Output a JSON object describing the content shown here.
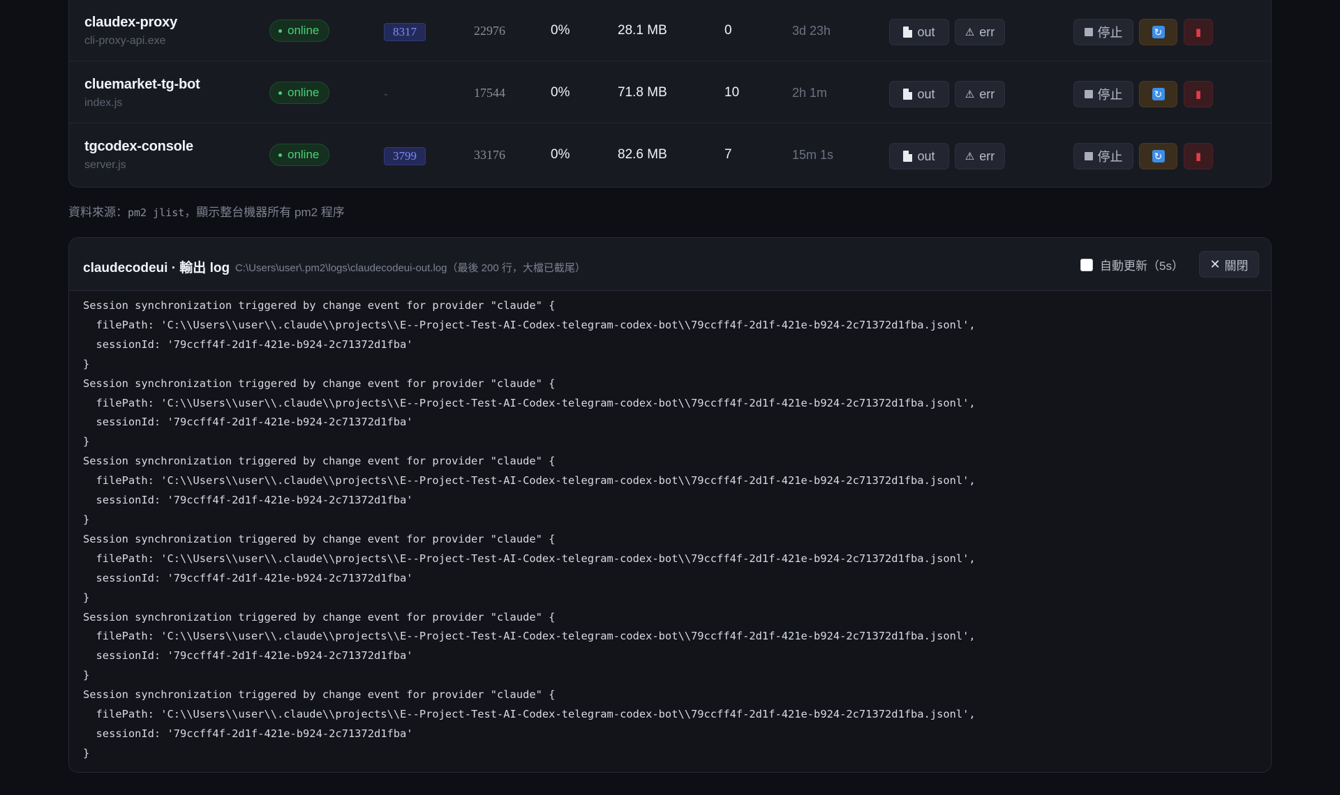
{
  "processes": [
    {
      "name": "claudex-proxy",
      "script": "cli-proxy-api.exe",
      "status": "online",
      "port": "8317",
      "pid": "22976",
      "cpu": "0%",
      "memory": "28.1 MB",
      "restarts": "0",
      "uptime": "3d 23h"
    },
    {
      "name": "cluemarket-tg-bot",
      "script": "index.js",
      "status": "online",
      "port": "-",
      "pid": "17544",
      "cpu": "0%",
      "memory": "71.8 MB",
      "restarts": "10",
      "uptime": "2h 1m"
    },
    {
      "name": "tgcodex-console",
      "script": "server.js",
      "status": "online",
      "port": "3799",
      "pid": "33176",
      "cpu": "0%",
      "memory": "82.6 MB",
      "restarts": "7",
      "uptime": "15m 1s"
    }
  ],
  "row_actions": {
    "out_label": "out",
    "err_label": "err",
    "stop_label": "停止"
  },
  "source_note": {
    "prefix": "資料來源：",
    "command": "pm2 jlist",
    "suffix": "，顯示整台機器所有 pm2 程序"
  },
  "log_panel": {
    "title": "claudecodeui · 輸出 log",
    "path": "C:\\Users\\user\\.pm2\\logs\\claudecodeui-out.log（最後 200 行，大檔已截尾）",
    "auto_refresh_label": "自動更新（5s）",
    "auto_refresh_checked": false,
    "close_label": "關閉",
    "lines": [
      "Session synchronization triggered by change event for provider \"claude\" {",
      "  filePath: 'C:\\\\Users\\\\user\\\\.claude\\\\projects\\\\E--Project-Test-AI-Codex-telegram-codex-bot\\\\79ccff4f-2d1f-421e-b924-2c71372d1fba.jsonl',",
      "  sessionId: '79ccff4f-2d1f-421e-b924-2c71372d1fba'",
      "}",
      "Session synchronization triggered by change event for provider \"claude\" {",
      "  filePath: 'C:\\\\Users\\\\user\\\\.claude\\\\projects\\\\E--Project-Test-AI-Codex-telegram-codex-bot\\\\79ccff4f-2d1f-421e-b924-2c71372d1fba.jsonl',",
      "  sessionId: '79ccff4f-2d1f-421e-b924-2c71372d1fba'",
      "}",
      "Session synchronization triggered by change event for provider \"claude\" {",
      "  filePath: 'C:\\\\Users\\\\user\\\\.claude\\\\projects\\\\E--Project-Test-AI-Codex-telegram-codex-bot\\\\79ccff4f-2d1f-421e-b924-2c71372d1fba.jsonl',",
      "  sessionId: '79ccff4f-2d1f-421e-b924-2c71372d1fba'",
      "}",
      "Session synchronization triggered by change event for provider \"claude\" {",
      "  filePath: 'C:\\\\Users\\\\user\\\\.claude\\\\projects\\\\E--Project-Test-AI-Codex-telegram-codex-bot\\\\79ccff4f-2d1f-421e-b924-2c71372d1fba.jsonl',",
      "  sessionId: '79ccff4f-2d1f-421e-b924-2c71372d1fba'",
      "}",
      "Session synchronization triggered by change event for provider \"claude\" {",
      "  filePath: 'C:\\\\Users\\\\user\\\\.claude\\\\projects\\\\E--Project-Test-AI-Codex-telegram-codex-bot\\\\79ccff4f-2d1f-421e-b924-2c71372d1fba.jsonl',",
      "  sessionId: '79ccff4f-2d1f-421e-b924-2c71372d1fba'",
      "}",
      "Session synchronization triggered by change event for provider \"claude\" {",
      "  filePath: 'C:\\\\Users\\\\user\\\\.claude\\\\projects\\\\E--Project-Test-AI-Codex-telegram-codex-bot\\\\79ccff4f-2d1f-421e-b924-2c71372d1fba.jsonl',",
      "  sessionId: '79ccff4f-2d1f-421e-b924-2c71372d1fba'",
      "}"
    ]
  },
  "colors": {
    "background": "#0e0f14",
    "card": "#181a22",
    "status_online": "#4ad07a",
    "port_badge": "#7d8cf2",
    "restart_button": "#3b2e1c",
    "delete_button": "#3a1b20",
    "delete_icon": "#e23d4a"
  },
  "icons": {
    "out": "file-icon",
    "err": "warning-icon",
    "stop": "stop-icon",
    "restart": "refresh-icon",
    "delete": "trash-icon",
    "close": "close-icon"
  }
}
